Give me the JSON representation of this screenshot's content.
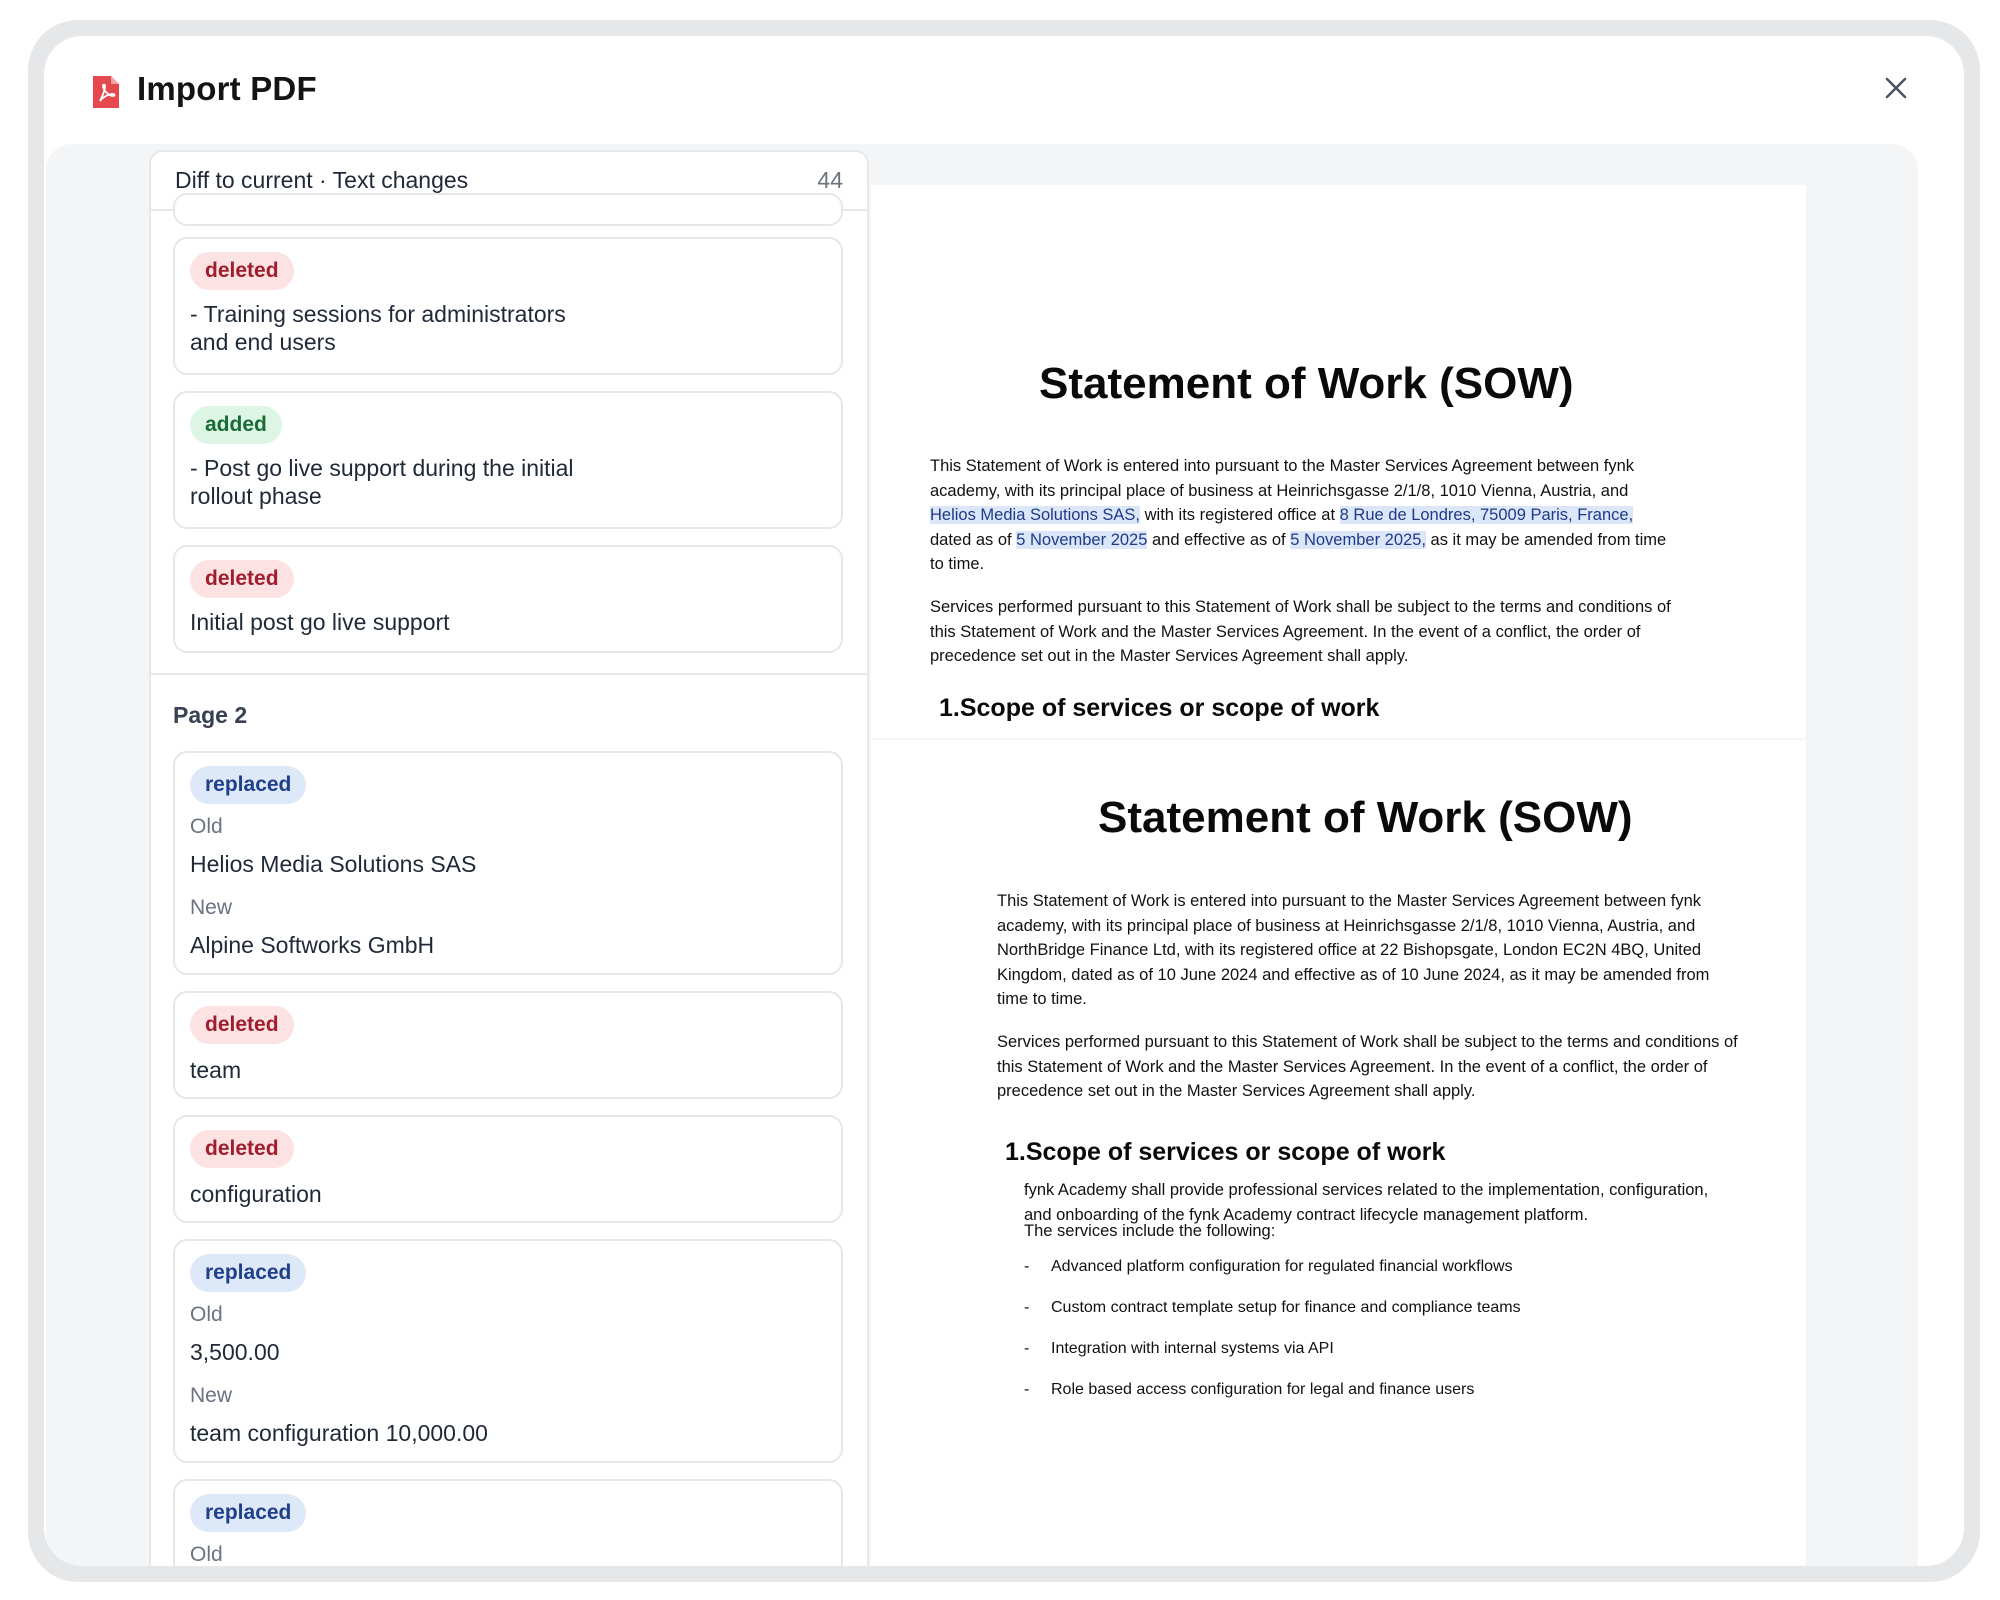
{
  "dialog": {
    "title": "Import PDF",
    "close_icon": "close-icon",
    "title_icon": "pdf-icon"
  },
  "diff_panel": {
    "header": "Diff to current · Text changes",
    "count": "44",
    "cards_top": [
      {
        "type": "deleted",
        "lines": [
          "- Training sessions for administrators",
          "and end users"
        ]
      },
      {
        "type": "added",
        "lines": [
          "- Post go live support during the initial",
          "rollout phase"
        ]
      },
      {
        "type": "deleted",
        "lines": [
          "Initial post go live support"
        ]
      }
    ],
    "page_label": "Page 2",
    "cards_page2": [
      {
        "type": "replaced",
        "old_label": "Old",
        "old": "Helios Media Solutions SAS",
        "new_label": "New",
        "new": "Alpine Softworks GmbH"
      },
      {
        "type": "deleted",
        "lines": [
          "team"
        ]
      },
      {
        "type": "deleted",
        "lines": [
          "configuration"
        ]
      },
      {
        "type": "replaced",
        "old_label": "Old",
        "old": "3,500.00",
        "new_label": "New",
        "new": "team configuration 10,000.00"
      },
      {
        "type": "replaced",
        "old_label": "Old"
      }
    ]
  },
  "doc_page1": {
    "title": "Statement of Work (SOW)",
    "p1_l1": "This Statement of Work is entered into pursuant to the Master Services Agreement between fynk",
    "p1_l2": "academy, with its principal place of business at Heinrichsgasse 2/1/8, 1010 Vienna, Austria, and",
    "p1_l3_hl1": "Helios Media Solutions SAS,",
    "p1_l3_mid": " with its registered office at ",
    "p1_l3_hl2": "8 Rue de Londres, 75009 Paris, France,",
    "p1_l4_a": "dated as of ",
    "p1_l4_hl1": "5 November 2025",
    "p1_l4_b": " and effective as of ",
    "p1_l4_hl2": "5 November 2025,",
    "p1_l4_c": " as it may be amended from time",
    "p1_l5": "to time.",
    "p2_l1": "Services performed pursuant to this Statement of Work shall be subject to the terms and conditions of",
    "p2_l2": "this Statement of Work and the Master Services Agreement. In the event of a conflict, the order of",
    "p2_l3": "precedence set out in the Master Services Agreement shall apply.",
    "section": "1.Scope of services or scope of work"
  },
  "doc_page2": {
    "title": "Statement of Work (SOW)",
    "p1": [
      "This Statement of Work is entered into pursuant to the Master Services Agreement between fynk",
      "academy, with its principal place of business at Heinrichsgasse 2/1/8, 1010 Vienna, Austria, and",
      "NorthBridge Finance Ltd, with its registered office at 22 Bishopsgate, London EC2N 4BQ, United",
      "Kingdom, dated as of 10 June 2024 and effective as of 10 June 2024, as it may be amended from",
      "time to time."
    ],
    "p2": [
      "Services performed pursuant to this Statement of Work shall be subject to the terms and conditions of",
      "this Statement of Work and the Master Services Agreement. In the event of a conflict, the order of",
      "precedence set out in the Master Services Agreement shall apply."
    ],
    "section": "1.Scope of services or scope of work",
    "scope": [
      "fynk Academy shall provide professional services related to the implementation, configuration,",
      "and onboarding of the fynk Academy contract lifecycle management platform."
    ],
    "intro": "The services include the following:",
    "bullet_mark": "-",
    "bullets": [
      "Advanced platform configuration for regulated financial workflows",
      "Custom contract template setup for finance and compliance teams",
      "Integration with internal systems via API",
      "Role based access configuration for legal and finance users"
    ]
  }
}
